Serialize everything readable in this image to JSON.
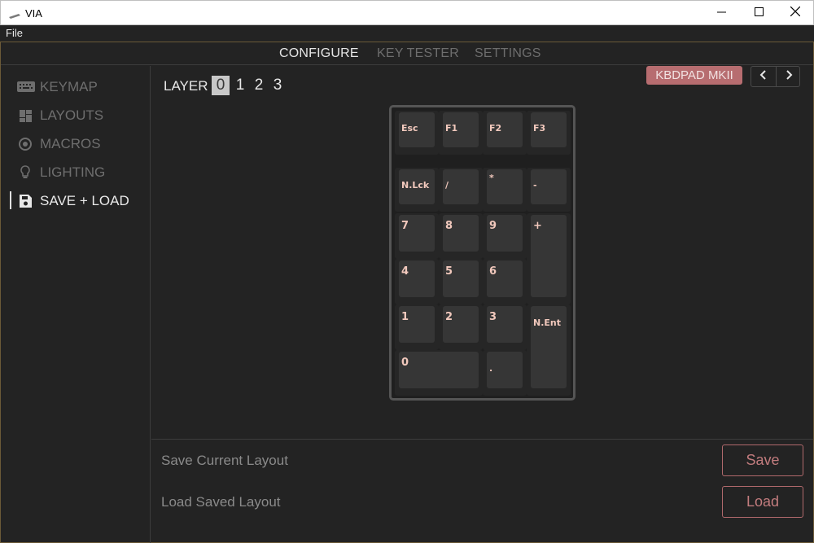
{
  "window": {
    "title": "VIA",
    "controls": [
      "minimize-icon",
      "maximize-icon",
      "close-icon"
    ]
  },
  "menu": {
    "file": "File"
  },
  "tabs": [
    {
      "label": "CONFIGURE",
      "active": true
    },
    {
      "label": "KEY TESTER",
      "active": false
    },
    {
      "label": "SETTINGS",
      "active": false
    }
  ],
  "sidebar": {
    "items": [
      {
        "label": "KEYMAP",
        "icon": "keyboard-icon",
        "active": false
      },
      {
        "label": "LAYOUTS",
        "icon": "layouts-icon",
        "active": false
      },
      {
        "label": "MACROS",
        "icon": "macros-icon",
        "active": false
      },
      {
        "label": "LIGHTING",
        "icon": "lightbulb-icon",
        "active": false
      },
      {
        "label": "SAVE + LOAD",
        "icon": "save-icon",
        "active": true
      }
    ]
  },
  "layer": {
    "label": "LAYER",
    "options": [
      "0",
      "1",
      "2",
      "3"
    ],
    "selected": "0"
  },
  "device": {
    "name": "KBDPAD MKII"
  },
  "keys": {
    "esc": "Esc",
    "f1": "F1",
    "f2": "F2",
    "f3": "F3",
    "numlock": "N.Lck",
    "slash": "/",
    "asterisk": "*",
    "minus": "-",
    "k7": "7",
    "k8": "8",
    "k9": "9",
    "plus": "+",
    "k4": "4",
    "k5": "5",
    "k6": "6",
    "k1": "1",
    "k2": "2",
    "k3": "3",
    "enter": "N.Ent",
    "k0": "0",
    "dot": "."
  },
  "save_load": {
    "save_label": "Save Current Layout",
    "save_button": "Save",
    "load_label": "Load Saved Layout",
    "load_button": "Load"
  },
  "colors": {
    "accent": "#b76d70",
    "key_text": "#f2c9bd",
    "background": "#232323"
  }
}
